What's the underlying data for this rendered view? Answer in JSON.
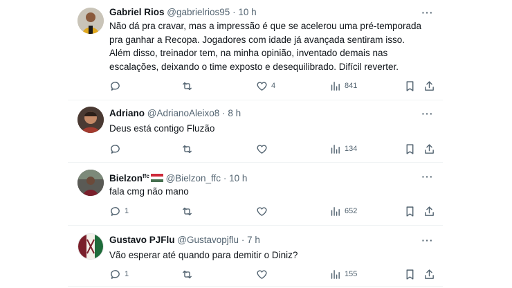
{
  "tweets": [
    {
      "name": "Gabriel Rios",
      "handle": "@gabrielrios95",
      "dot": "·",
      "time": "10 h",
      "text": "Não dá pra cravar, mas a impressão é que se acelerou uma pré-temporada pra ganhar a Recopa. Jogadores com idade já avançada sentiram isso. Além disso, treinador tem, na minha opinião, inventado demais nas escalações, deixando o time exposto e desequilibrado. Difícil reverter.",
      "replies": "",
      "retweets": "",
      "likes": "4",
      "views": "841"
    },
    {
      "name": "Adriano",
      "handle": "@AdrianoAleixo8",
      "dot": "·",
      "time": "8 h",
      "text": "Deus está contigo Fluzão",
      "replies": "",
      "retweets": "",
      "likes": "",
      "views": "134"
    },
    {
      "name": "Bielzon",
      "name_badge": "ffc",
      "handle": "@Bielzon_ffc",
      "dot": "·",
      "time": "10 h",
      "text": "fala cmg não mano",
      "replies": "1",
      "retweets": "",
      "likes": "",
      "views": "652"
    },
    {
      "name": "Gustavo PJFlu",
      "handle": "@Gustavopjflu",
      "dot": "·",
      "time": "7 h",
      "text": "Vão esperar até quando para demitir o Diniz?",
      "replies": "1",
      "retweets": "",
      "likes": "",
      "views": "155"
    }
  ],
  "icons": {
    "more": "more-icon",
    "reply": "reply-icon",
    "retweet": "retweet-icon",
    "like": "heart-icon",
    "views": "views-icon",
    "bookmark": "bookmark-icon",
    "share": "share-icon",
    "flag": "hungary-flag-icon"
  },
  "colors": {
    "text": "#0f1419",
    "secondary": "#536471",
    "divider": "#eff3f4"
  }
}
